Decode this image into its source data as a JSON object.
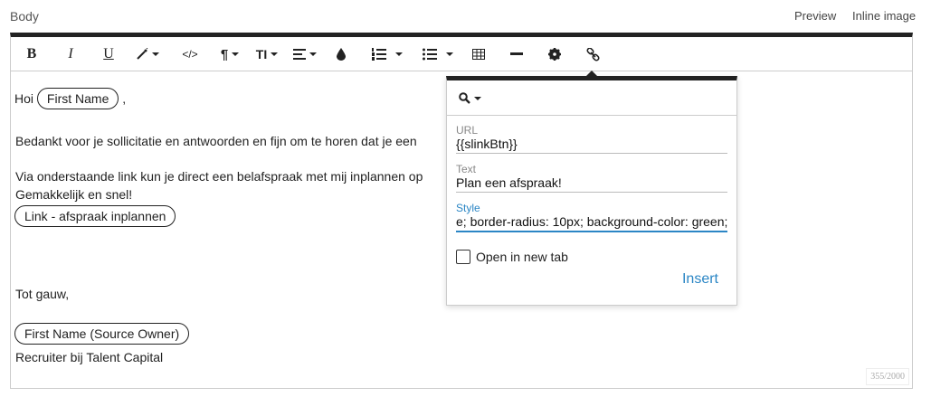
{
  "header": {
    "body_label": "Body",
    "preview_label": "Preview",
    "inline_image_label": "Inline image"
  },
  "toolbar": {
    "bold": "B",
    "italic": "I",
    "underline": "U",
    "code": "</>",
    "paragraph": "¶",
    "font_size": "TI"
  },
  "content": {
    "greeting_prefix": "Hoi",
    "greeting_pill": "First Name",
    "greeting_suffix": ",",
    "line1": "Bedankt voor je sollicitatie en antwoorden en fijn om te horen dat je een",
    "line2": "Via onderstaande link kun je direct een belafspraak met mij inplannen op",
    "line3": "Gemakkelijk en snel!",
    "link_pill": "Link - afspraak inplannen",
    "closing": "Tot gauw,",
    "owner_pill": "First Name (Source Owner)",
    "signature": "Recruiter bij Talent Capital"
  },
  "counter": "355/2000",
  "link_dialog": {
    "url_label": "URL",
    "url_value": "{{slinkBtn}}",
    "text_label": "Text",
    "text_value": "Plan een afspraak!",
    "style_label": "Style",
    "style_value": "e; border-radius: 10px; background-color: green;",
    "new_tab_label": "Open in new tab",
    "insert_label": "Insert"
  }
}
